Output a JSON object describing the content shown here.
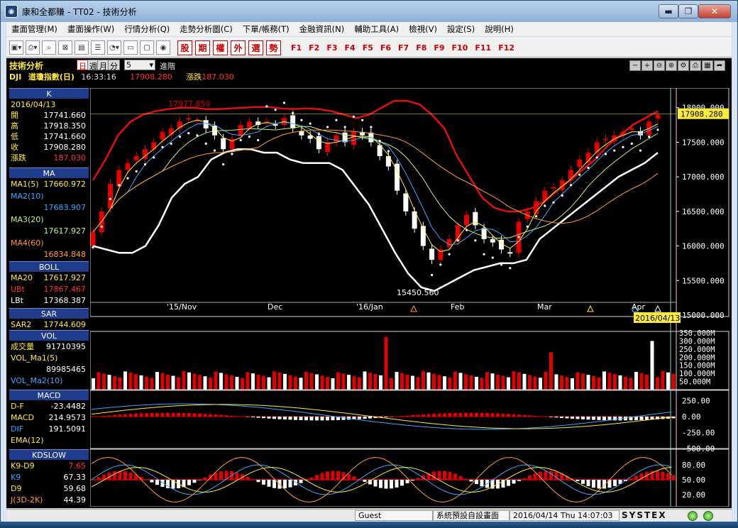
{
  "window": {
    "title": "康和全都賺 - TT02 - 技術分析",
    "min_label": "▬",
    "max_label": "❐",
    "close_label": "✕"
  },
  "menu": [
    "畫面管理(M)",
    "畫面操作(W)",
    "行情分析(Q)",
    "走勢分析圖(C)",
    "下單/帳務(T)",
    "金融資訊(N)",
    "輔助工具(A)",
    "檢視(V)",
    "設定(S)",
    "說明(H)"
  ],
  "toolbar": {
    "quick_keys": [
      "股",
      "期",
      "權",
      "外",
      "選",
      "勢"
    ],
    "f_keys": [
      "F1",
      "F2",
      "F3",
      "F4",
      "F5",
      "F6",
      "F7",
      "F8",
      "F9",
      "F10",
      "F11",
      "F12"
    ]
  },
  "header": {
    "panel_title": "技術分析",
    "periods": {
      "day": "日",
      "week": "週",
      "month": "月",
      "minute": "分"
    },
    "period_count": "5",
    "advanced": "進階",
    "symbol": "DJI",
    "name": "道瓊指數(日)",
    "time": "16:33:16",
    "price": "17908.280",
    "change_label": "漲跌",
    "change": "187.030"
  },
  "legend": {
    "k": {
      "title": "K",
      "date": "2016/04/13",
      "rows": [
        {
          "label": "開",
          "value": "17741.660"
        },
        {
          "label": "高",
          "value": "17918.350"
        },
        {
          "label": "低",
          "value": "17741.660"
        },
        {
          "label": "收",
          "value": "17908.280"
        },
        {
          "label": "漲跌",
          "value": "187.030"
        }
      ]
    },
    "ma": {
      "title": "MA",
      "rows": [
        {
          "label": "MA1(5)",
          "value": "17660.972"
        },
        {
          "label": "MA2(10)",
          "value": "17683.907"
        },
        {
          "label": "MA3(20)",
          "value": "17617.927"
        },
        {
          "label": "MA4(60)",
          "value": "16834.848"
        }
      ]
    },
    "boll": {
      "title": "BOLL",
      "rows": [
        {
          "label": "MA20",
          "value": "17617.927"
        },
        {
          "label": "UBt",
          "value": "17867.467"
        },
        {
          "label": "LBt",
          "value": "17368.387"
        }
      ]
    },
    "sar": {
      "title": "SAR",
      "label": "SAR2",
      "value": "17744.609"
    },
    "vol": {
      "title": "VOL",
      "rows": [
        {
          "label": "成交量",
          "value": "91710395"
        },
        {
          "label": "VOL_Ma1(5)",
          "value": "89985465"
        },
        {
          "label": "VOL_Ma2(10)",
          "value": ""
        }
      ]
    },
    "macd": {
      "title": "MACD",
      "rows": [
        {
          "label": "D-F",
          "value": "-23.4482"
        },
        {
          "label": "MACD",
          "value": "214.9573"
        },
        {
          "label": "DIF",
          "value": "191.5091"
        },
        {
          "label": "EMA(12)",
          "value": ""
        }
      ]
    },
    "kd": {
      "title": "KDSLOW",
      "rows": [
        {
          "label": "K9-D9",
          "value": "7.65"
        },
        {
          "label": "K9",
          "value": "67.33"
        },
        {
          "label": "D9",
          "value": "59.68"
        },
        {
          "label": "J(3D-2K)",
          "value": "44.39"
        }
      ]
    }
  },
  "chart_data": [
    {
      "type": "candlestick",
      "title": "",
      "x_labels": [
        "'15/Nov",
        "Dec",
        "'16/Jan",
        "Feb",
        "Mar",
        "Apr"
      ],
      "y_ticks": [
        "18000.000",
        "17500.000",
        "17000.000",
        "16500.000",
        "16000.000",
        "15500.000",
        "15000.000"
      ],
      "ylim": [
        15000,
        18100
      ],
      "annotations": {
        "high_label": "17977.850",
        "low_label": "15450.560",
        "last_price": "17908.280",
        "cursor_date": "2016/04/13"
      },
      "series": [
        {
          "name": "close",
          "values": [
            16200,
            16500,
            16900,
            17100,
            17200,
            17300,
            17400,
            17500,
            17650,
            17700,
            17800,
            17850,
            17820,
            17700,
            17600,
            17400,
            17550,
            17750,
            17800,
            17750,
            17800,
            17750,
            17850,
            17700,
            17600,
            17550,
            17400,
            17500,
            17600,
            17500,
            17650,
            17600,
            17500,
            17300,
            17150,
            16800,
            16500,
            16250,
            16000,
            15800,
            15950,
            16100,
            16300,
            16450,
            16300,
            16100,
            16050,
            15950,
            15900,
            16350,
            16500,
            16650,
            16800,
            16850,
            16950,
            17100,
            17250,
            17350,
            17500,
            17550,
            17600,
            17650,
            17700,
            17600,
            17800,
            17900
          ]
        },
        {
          "name": "BOLL upper",
          "values": [
            16950,
            17250,
            17600,
            17800,
            17900,
            17950,
            17980,
            18000,
            18000,
            17980,
            17980,
            17990,
            18000,
            18010,
            18010,
            17990,
            17980,
            17990,
            17980,
            17950,
            17900,
            17850,
            17900,
            18000,
            18100,
            18100,
            18050,
            17900,
            17700,
            17300,
            17000,
            16700,
            16550,
            16500,
            16500,
            16550,
            16650,
            16800,
            16950,
            17100,
            17250,
            17450,
            17600,
            17750,
            17850,
            17950
          ]
        },
        {
          "name": "BOLL lower",
          "values": [
            16000,
            15950,
            15900,
            15900,
            16000,
            16300,
            16700,
            16900,
            17000,
            17250,
            17350,
            17400,
            17400,
            17350,
            17350,
            17250,
            17200,
            17200,
            17200,
            17100,
            16850,
            16600,
            16250,
            15900,
            15600,
            15400,
            15350,
            15450,
            15550,
            15650,
            15700,
            15750,
            15750,
            15800,
            16100,
            16250,
            16400,
            16550,
            16700,
            16850,
            17000,
            17100,
            17200,
            17350
          ]
        }
      ]
    },
    {
      "type": "bar",
      "title": "",
      "y_ticks": [
        "350.000M",
        "300.000M",
        "250.000M",
        "200.000M",
        "150.000M",
        "100.000M",
        "50.000M"
      ],
      "ylim": [
        0,
        350
      ]
    },
    {
      "type": "bar",
      "title": "",
      "y_ticks": [
        "250.00",
        "0.00",
        "-250.00",
        "-500.00"
      ],
      "ylim": [
        -500,
        300
      ]
    },
    {
      "type": "line",
      "title": "",
      "y_ticks": [
        "80.00",
        "50.00",
        "20.00"
      ],
      "ylim": [
        0,
        100
      ]
    }
  ],
  "status": {
    "user": "Guest",
    "layout": "系統預設自設畫面",
    "datetime": "2016/04/14 Thu 14:07:03",
    "brand": "SYSTEX"
  },
  "colors": {
    "up": "#e00000",
    "down": "#ffffff",
    "boll": "#e01010",
    "sar": "#ffffff",
    "panel_header": "#1f3b8c",
    "label_yellow": "#ffeb3b",
    "label_cyan": "#38a8ff",
    "label_red": "#ff3030"
  }
}
